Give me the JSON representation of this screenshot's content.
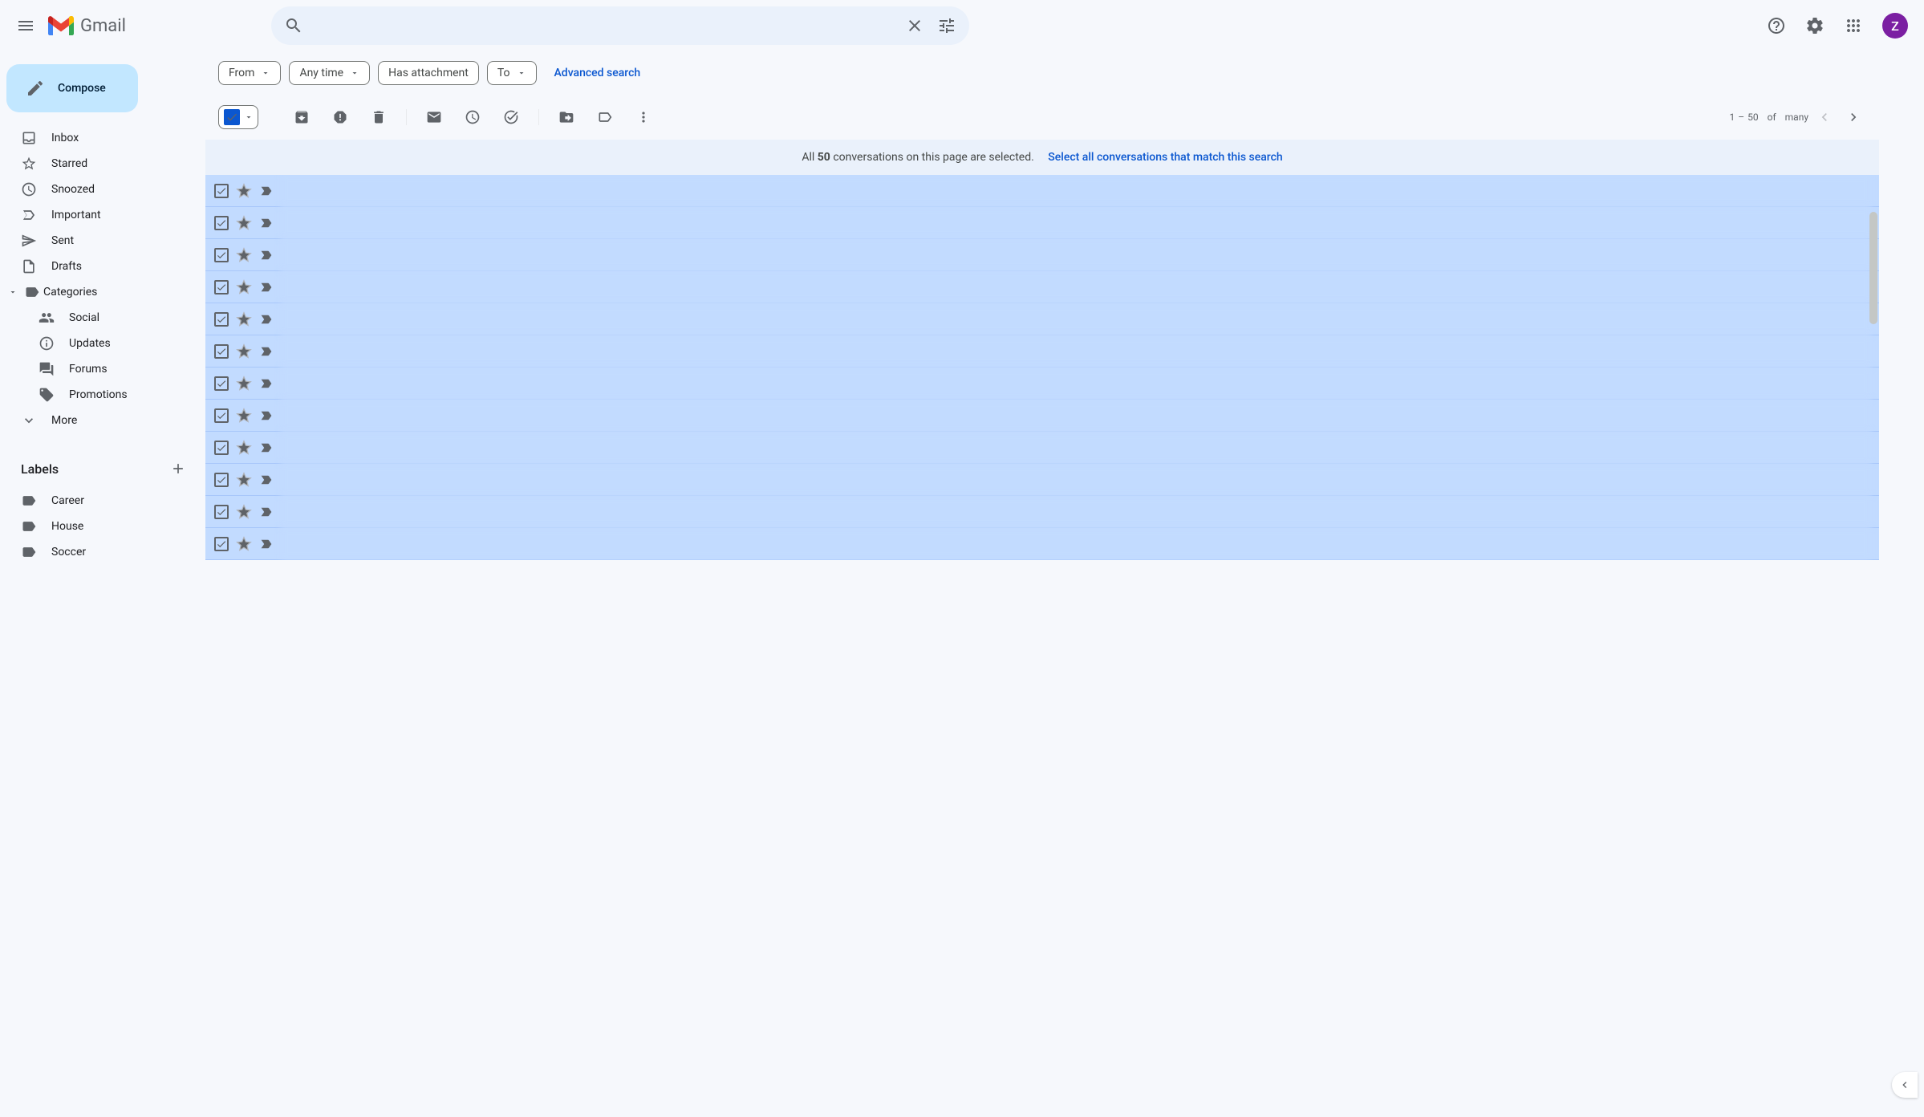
{
  "header": {
    "app_name": "Gmail",
    "search_placeholder": "",
    "avatar_initial": "Z"
  },
  "sidebar": {
    "compose_label": "Compose",
    "nav": [
      {
        "label": "Inbox",
        "icon": "inbox"
      },
      {
        "label": "Starred",
        "icon": "star"
      },
      {
        "label": "Snoozed",
        "icon": "clock"
      },
      {
        "label": "Important",
        "icon": "important"
      },
      {
        "label": "Sent",
        "icon": "send"
      },
      {
        "label": "Drafts",
        "icon": "draft"
      },
      {
        "label": "Categories",
        "icon": "label",
        "expanded": true
      }
    ],
    "categories": [
      {
        "label": "Social",
        "icon": "people"
      },
      {
        "label": "Updates",
        "icon": "info"
      },
      {
        "label": "Forums",
        "icon": "forum"
      },
      {
        "label": "Promotions",
        "icon": "tag"
      }
    ],
    "more_label": "More",
    "labels_header": "Labels",
    "labels": [
      {
        "label": "Career"
      },
      {
        "label": "House"
      },
      {
        "label": "Soccer"
      }
    ]
  },
  "filters": {
    "from": "From",
    "any_time": "Any time",
    "has_attachment": "Has attachment",
    "to": "To",
    "advanced": "Advanced search"
  },
  "pagination": {
    "range_start": "1",
    "range_end": "50",
    "of_label": "of",
    "total": "many"
  },
  "selection_banner": {
    "prefix": "All ",
    "count": "50",
    "suffix": " conversations on this page are selected.",
    "select_all_link": "Select all conversations that match this search"
  },
  "mail_rows": 12,
  "colors": {
    "accent": "#0b57d0",
    "compose_bg": "#c2e7ff",
    "selected_row": "#c2dbff",
    "star_important": "#f4b400"
  }
}
